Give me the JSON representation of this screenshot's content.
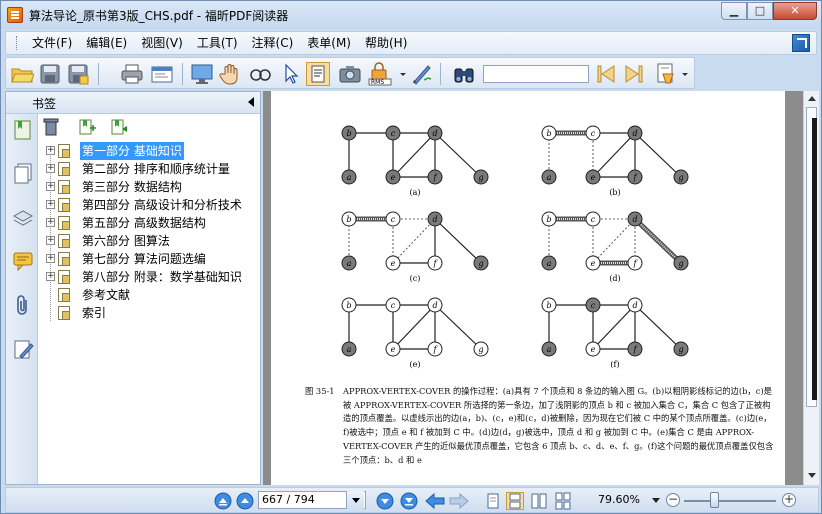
{
  "window": {
    "title": "算法导论_原书第3版_CHS.pdf - 福昕PDF阅读器",
    "buttons": {
      "minimize": "▁",
      "maximize": "□",
      "close": "✕"
    }
  },
  "menu": {
    "items": [
      "文件(F)",
      "编辑(E)",
      "视图(V)",
      "工具(T)",
      "注释(C)",
      "表单(M)",
      "帮助(H)"
    ]
  },
  "toolbar": {
    "search_value": "",
    "tools": [
      "open-folder",
      "save",
      "save-as",
      "print",
      "properties",
      "fullscreen",
      "hand-tool",
      "zoom-tool",
      "select-tool",
      "text-select-tool",
      "snapshot",
      "rms",
      "sign",
      "find",
      "prev-result",
      "next-result",
      "highlight"
    ]
  },
  "sidebar": {
    "title": "书签",
    "items": [
      {
        "label": "第一部分 基础知识",
        "expandable": true,
        "selected": true
      },
      {
        "label": "第二部分 排序和顺序统计量",
        "expandable": true,
        "selected": false
      },
      {
        "label": "第三部分 数据结构",
        "expandable": true,
        "selected": false
      },
      {
        "label": "第四部分 高级设计和分析技术",
        "expandable": true,
        "selected": false
      },
      {
        "label": "第五部分 高级数据结构",
        "expandable": true,
        "selected": false
      },
      {
        "label": "第六部分 图算法",
        "expandable": true,
        "selected": false
      },
      {
        "label": "第七部分 算法问题选编",
        "expandable": true,
        "selected": false
      },
      {
        "label": "第八部分 附录：数学基础知识",
        "expandable": true,
        "selected": false
      },
      {
        "label": "参考文献",
        "expandable": false,
        "selected": false
      },
      {
        "label": "索引",
        "expandable": false,
        "selected": false
      }
    ],
    "rail_icons": [
      "bookmarks-icon",
      "pages-icon",
      "layers-icon",
      "comments-icon",
      "attachments-icon",
      "signatures-icon"
    ]
  },
  "document": {
    "subfigures": [
      {
        "label": "(a)",
        "nodes": [
          "b",
          "c",
          "d",
          "a",
          "e",
          "f",
          "g"
        ]
      },
      {
        "label": "(b)",
        "nodes": [
          "b",
          "c",
          "d",
          "a",
          "e",
          "f",
          "g"
        ]
      },
      {
        "label": "(c)",
        "nodes": [
          "b",
          "c",
          "d",
          "a",
          "e",
          "f",
          "g"
        ]
      },
      {
        "label": "(d)",
        "nodes": [
          "b",
          "c",
          "d",
          "a",
          "e",
          "f",
          "g"
        ]
      },
      {
        "label": "(e)",
        "nodes": [
          "b",
          "c",
          "d",
          "a",
          "e",
          "f",
          "g"
        ]
      },
      {
        "label": "(f)",
        "nodes": [
          "b",
          "c",
          "d",
          "a",
          "e",
          "f",
          "g"
        ]
      }
    ],
    "caption_label": "图 35-1",
    "caption_body": "APPROX-VERTEX-COVER 的操作过程：(a)具有 7 个顶点和 8 条边的输入图 G。(b)以粗阴影线标记的边(b，c)是被 APPROX-VERTEX-COVER 所选择的第一条边，加了浅阴影的顶点 b 和 c 被加入集合 C，集合 C 包含了正被构造的顶点覆盖。以虚线示出的边(a，b)、(c，e)和(c，d)被删除，因为现在它们被 C 中的某个顶点所覆盖。(c)边(e，f)被选中；顶点 e 和 f 被加到 C 中。(d)边(d，g)被选中，顶点 d 和 g 被加到 C 中。(e)集合 C 是由 APPROX-VERTEX-COVER 产生的近似最优顶点覆盖，它包含 6 顶点 b、c、d、e、f、g。(f)这个问题的最优顶点覆盖仅包含三个顶点：b、d 和 e"
  },
  "status": {
    "page_value": "667 / 794",
    "zoom": "79.60%",
    "zoom_level": 0.33
  }
}
